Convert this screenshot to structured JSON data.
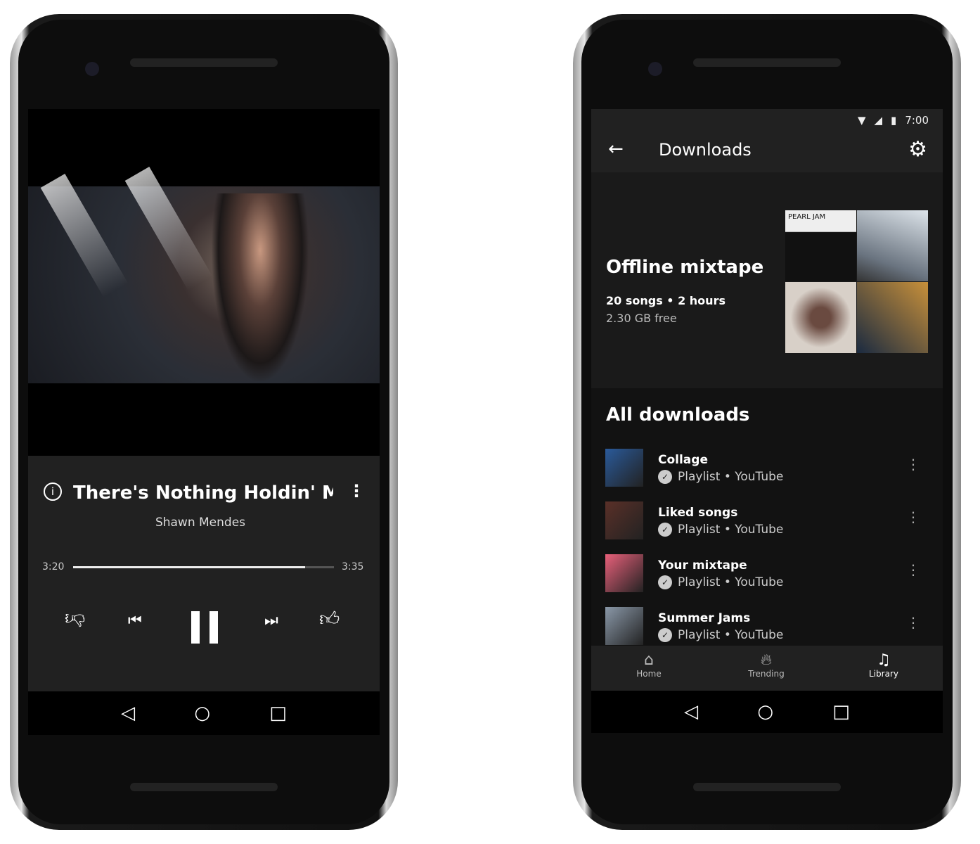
{
  "player": {
    "title": "There's Nothing Holdin' Me B",
    "artist": "Shawn Mendes",
    "elapsed": "3:20",
    "duration": "3:35",
    "progress": 0.89,
    "icons": [
      "info-icon",
      "more-vert-icon",
      "thumb-down-icon",
      "skip-previous-icon",
      "pause-icon",
      "skip-next-icon",
      "thumb-up-icon"
    ]
  },
  "status_bar": {
    "time": "7:00"
  },
  "downloads": {
    "title": "Downloads",
    "mixtape": {
      "title": "Offline mixtape",
      "meta": "20 songs • 2 hours",
      "free": "2.30 GB free",
      "art_text": "PEARL JAM"
    },
    "section_title": "All downloads",
    "items": [
      {
        "title": "Collage",
        "subtitle": "Playlist • YouTube",
        "color": "#2a5a9a"
      },
      {
        "title": "Liked songs",
        "subtitle": "Playlist • YouTube",
        "color": "#5a3028"
      },
      {
        "title": "Your mixtape",
        "subtitle": "Playlist • YouTube",
        "color": "#e8607a"
      },
      {
        "title": "Summer Jams",
        "subtitle": "Playlist • YouTube",
        "color": "#8a98a8"
      }
    ],
    "bottom_nav": [
      {
        "label": "Home"
      },
      {
        "label": "Trending"
      },
      {
        "label": "Library"
      }
    ]
  },
  "colors": {
    "panel": "#212121",
    "list_bg": "#121212",
    "mixtape_bg": "#1a1a1a"
  }
}
